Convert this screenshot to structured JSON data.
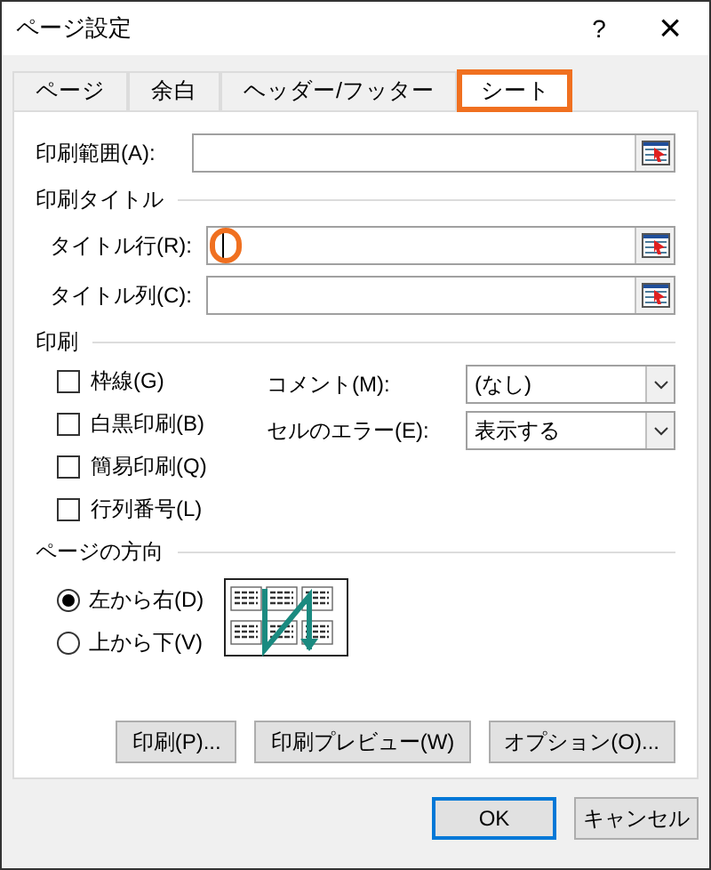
{
  "window": {
    "title": "ページ設定",
    "help": "?",
    "close": "×"
  },
  "tabs": [
    {
      "label": "ページ",
      "selected": false,
      "highlighted": false
    },
    {
      "label": "余白",
      "selected": false,
      "highlighted": false
    },
    {
      "label": "ヘッダー/フッター",
      "selected": false,
      "highlighted": false
    },
    {
      "label": "シート",
      "selected": true,
      "highlighted": true
    }
  ],
  "print_area": {
    "label": "印刷範囲(A):",
    "focused": false,
    "highlighted": false
  },
  "print_titles": {
    "heading": "印刷タイトル",
    "fields": [
      {
        "label": "タイトル行(R):",
        "focused": true,
        "highlighted": true
      },
      {
        "label": "タイトル列(C):",
        "focused": false,
        "highlighted": false
      }
    ]
  },
  "print": {
    "heading": "印刷",
    "checkboxes": [
      {
        "label": "枠線(G)",
        "checked": false
      },
      {
        "label": "白黒印刷(B)",
        "checked": false
      },
      {
        "label": "簡易印刷(Q)",
        "checked": false
      },
      {
        "label": "行列番号(L)",
        "checked": false
      }
    ],
    "dropdowns": [
      {
        "label": "コメント(M):",
        "value": "(なし)"
      },
      {
        "label": "セルのエラー(E):",
        "value": "表示する"
      }
    ]
  },
  "page_order": {
    "heading": "ページの方向",
    "options": [
      {
        "label": "左から右(D)",
        "selected": true
      },
      {
        "label": "上から下(V)",
        "selected": false
      }
    ]
  },
  "panel_buttons": [
    "印刷(P)...",
    "印刷プレビュー(W)",
    "オプション(O)..."
  ],
  "buttons": [
    {
      "label": "OK",
      "default": true
    },
    {
      "label": "キャンセル",
      "default": false
    }
  ]
}
